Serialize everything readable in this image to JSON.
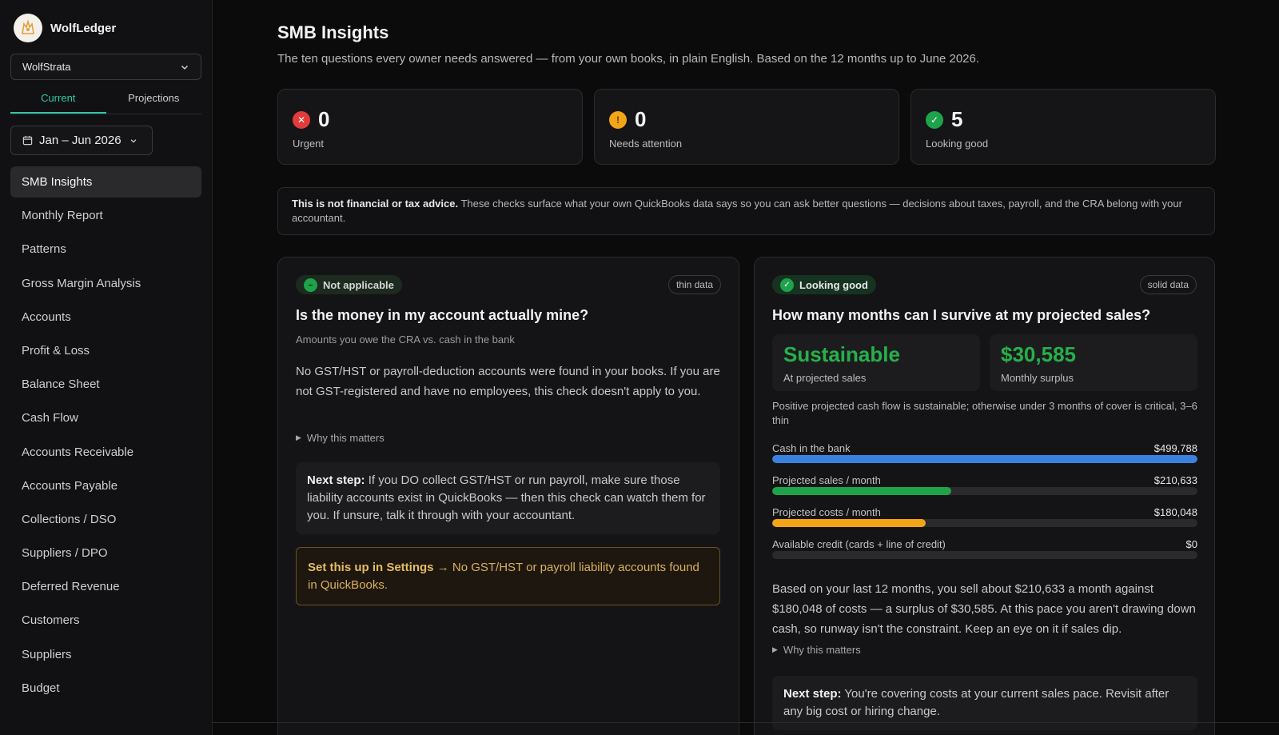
{
  "brand": {
    "name": "WolfLedger"
  },
  "org_select": {
    "value": "WolfStrata"
  },
  "tabs": [
    {
      "label": "Current",
      "active": true
    },
    {
      "label": "Projections",
      "active": false
    }
  ],
  "date_range": {
    "label": "Jan – Jun 2026"
  },
  "nav": [
    {
      "label": "SMB Insights",
      "active": true
    },
    {
      "label": "Monthly Report"
    },
    {
      "label": "Patterns"
    },
    {
      "label": "Gross Margin Analysis"
    },
    {
      "label": "Accounts"
    },
    {
      "label": "Profit & Loss"
    },
    {
      "label": "Balance Sheet"
    },
    {
      "label": "Cash Flow"
    },
    {
      "label": "Accounts Receivable"
    },
    {
      "label": "Accounts Payable"
    },
    {
      "label": "Collections / DSO"
    },
    {
      "label": "Suppliers / DPO"
    },
    {
      "label": "Deferred Revenue"
    },
    {
      "label": "Customers"
    },
    {
      "label": "Suppliers"
    },
    {
      "label": "Budget"
    }
  ],
  "page": {
    "title": "SMB Insights",
    "subtitle": "The ten questions every owner needs answered — from your own books, in plain English. Based on the 12 months up to June 2026."
  },
  "stats": [
    {
      "value": "0",
      "label": "Urgent",
      "icon": "x-icon",
      "color": "#e23b3b"
    },
    {
      "value": "0",
      "label": "Needs attention",
      "icon": "exclamation-icon",
      "color": "#f2a516"
    },
    {
      "value": "5",
      "label": "Looking good",
      "icon": "check-icon",
      "color": "#1ea34a"
    }
  ],
  "disclaimer": {
    "bold": "This is not financial or tax advice.",
    "text": " These checks surface what your own QuickBooks data says so you can ask better questions — decisions about taxes, payroll, and the CRA belong with your accountant."
  },
  "card_left": {
    "status": "Not applicable",
    "tag": "thin data",
    "title": "Is the money in my account actually mine?",
    "subtitle": "Amounts you owe the CRA vs. cash in the bank",
    "body": "No GST/HST or payroll-deduction accounts were found in your books. If you are not GST-registered and have no employees, this check doesn't apply to you.",
    "why": "Why this matters",
    "next_label": "Next step:",
    "next_text": " If you DO collect GST/HST or run payroll, make sure those liability accounts exist in QuickBooks — then this check can watch them for you. If unsure, talk it through with your accountant.",
    "setup_link": "Set this up in Settings",
    "setup_arrow": "→",
    "setup_text": " No GST/HST or payroll liability accounts found in QuickBooks."
  },
  "card_right": {
    "status": "Looking good",
    "tag": "solid data",
    "title": "How many months can I survive at my projected sales?",
    "metrics": [
      {
        "value": "Sustainable",
        "label": "At projected sales"
      },
      {
        "value": "$30,585",
        "label": "Monthly surplus"
      }
    ],
    "note": "Positive projected cash flow is sustainable; otherwise under 3 months of cover is critical, 3–6 thin",
    "bars": [
      {
        "label": "Cash in the bank",
        "value": "$499,788",
        "fill_fraction": 1.0,
        "color": "#3a82e0"
      },
      {
        "label": "Projected sales / month",
        "value": "$210,633",
        "fill_fraction": 0.421,
        "color": "#1ea34a"
      },
      {
        "label": "Projected costs / month",
        "value": "$180,048",
        "fill_fraction": 0.36,
        "color": "#f2a516"
      },
      {
        "label": "Available credit (cards + line of credit)",
        "value": "$0",
        "fill_fraction": 0,
        "color": "#3a82e0"
      }
    ],
    "body": "Based on your last 12 months, you sell about $210,633 a month against $180,048 of costs — a surplus of $30,585. At this pace you aren't drawing down cash, so runway isn't the constraint. Keep an eye on it if sales dip.",
    "why": "Why this matters",
    "next_label": "Next step:",
    "next_text": " You're covering costs at your current sales pace. Revisit after any big cost or hiring change."
  }
}
